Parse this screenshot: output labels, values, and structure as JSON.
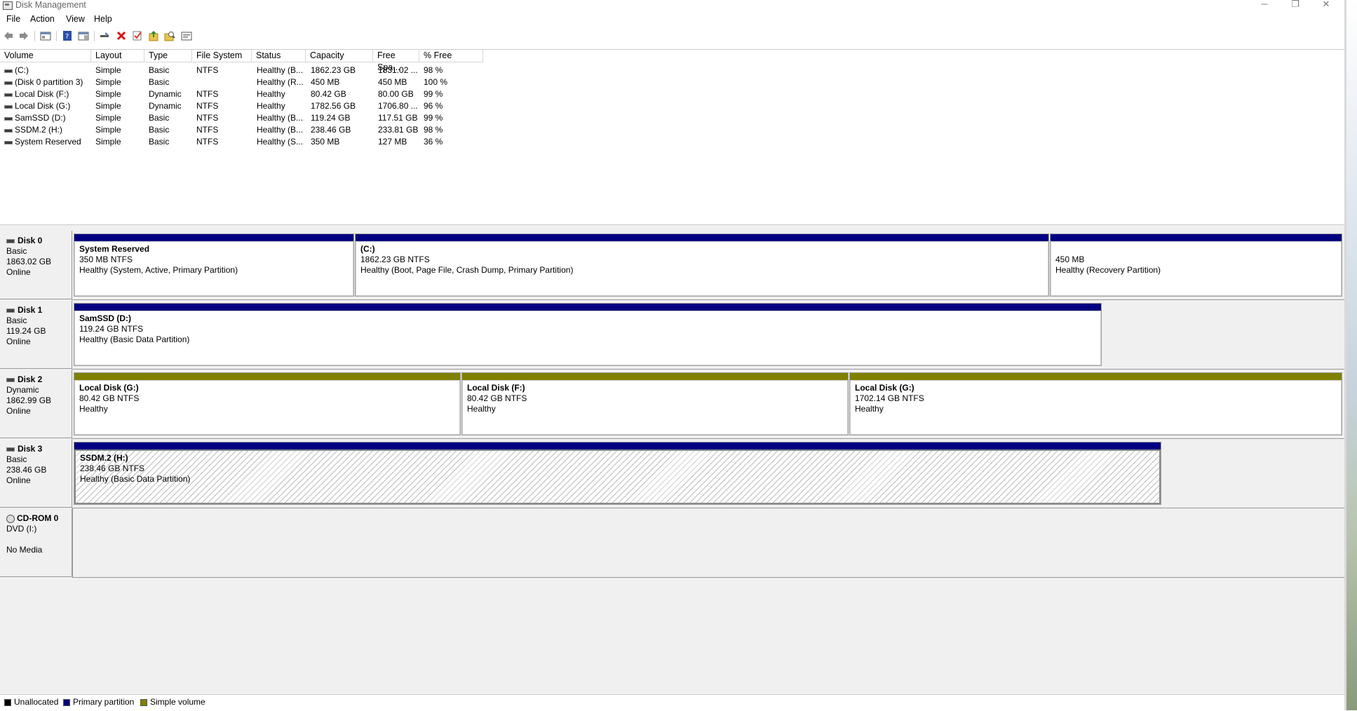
{
  "window": {
    "title": "Disk Management",
    "controls": {
      "minimize": "─",
      "restore": "❐",
      "close": "✕"
    }
  },
  "menu": [
    "File",
    "Action",
    "View",
    "Help"
  ],
  "list": {
    "columns": [
      "Volume",
      "Layout",
      "Type",
      "File System",
      "Status",
      "Capacity",
      "Free Spa...",
      "% Free"
    ],
    "rows": [
      [
        "(C:)",
        "Simple",
        "Basic",
        "NTFS",
        "Healthy (B...",
        "1862.23 GB",
        "1831.02 ...",
        "98 %"
      ],
      [
        "(Disk 0 partition 3)",
        "Simple",
        "Basic",
        "",
        "Healthy (R...",
        "450 MB",
        "450 MB",
        "100 %"
      ],
      [
        "Local Disk  (F:)",
        "Simple",
        "Dynamic",
        "NTFS",
        "Healthy",
        "80.42 GB",
        "80.00 GB",
        "99 %"
      ],
      [
        "Local Disk (G:)",
        "Simple",
        "Dynamic",
        "NTFS",
        "Healthy",
        "1782.56 GB",
        "1706.80 ...",
        "96 %"
      ],
      [
        "SamSSD (D:)",
        "Simple",
        "Basic",
        "NTFS",
        "Healthy (B...",
        "119.24 GB",
        "117.51 GB",
        "99 %"
      ],
      [
        "SSDM.2 (H:)",
        "Simple",
        "Basic",
        "NTFS",
        "Healthy (B...",
        "238.46 GB",
        "233.81 GB",
        "98 %"
      ],
      [
        "System Reserved",
        "Simple",
        "Basic",
        "NTFS",
        "Healthy (S...",
        "350 MB",
        "127 MB",
        "36 %"
      ]
    ]
  },
  "disks": [
    {
      "name": "Disk 0",
      "type": "Basic",
      "size": "1863.02 GB",
      "status": "Online",
      "partitions": [
        {
          "name": "System Reserved",
          "size": "350 MB NTFS",
          "status": "Healthy (System, Active, Primary Partition)",
          "bar": "primary"
        },
        {
          "name": "(C:)",
          "size": "1862.23 GB NTFS",
          "status": "Healthy (Boot, Page File, Crash Dump, Primary Partition)",
          "bar": "primary"
        },
        {
          "name": "",
          "size": "450 MB",
          "status": "Healthy (Recovery Partition)",
          "bar": "primary"
        }
      ]
    },
    {
      "name": "Disk 1",
      "type": "Basic",
      "size": "119.24 GB",
      "status": "Online",
      "partitions": [
        {
          "name": "SamSSD  (D:)",
          "size": "119.24 GB NTFS",
          "status": "Healthy (Basic Data Partition)",
          "bar": "primary"
        }
      ]
    },
    {
      "name": "Disk 2",
      "type": "Dynamic",
      "size": "1862.99 GB",
      "status": "Online",
      "partitions": [
        {
          "name": "Local Disk  (G:)",
          "size": "80.42 GB NTFS",
          "status": "Healthy",
          "bar": "simple"
        },
        {
          "name": "Local Disk   (F:)",
          "size": "80.42 GB NTFS",
          "status": "Healthy",
          "bar": "simple"
        },
        {
          "name": "Local Disk  (G:)",
          "size": "1702.14 GB NTFS",
          "status": "Healthy",
          "bar": "simple"
        }
      ]
    },
    {
      "name": "Disk 3",
      "type": "Basic",
      "size": "238.46 GB",
      "status": "Online",
      "partitions": [
        {
          "name": "SSDM.2  (H:)",
          "size": "238.46 GB NTFS",
          "status": "Healthy (Basic Data Partition)",
          "bar": "primary",
          "selected": true
        }
      ]
    }
  ],
  "cdrom": {
    "name": "CD-ROM 0",
    "type": "DVD (I:)",
    "status": "No Media"
  },
  "legend": [
    {
      "label": "Unallocated",
      "color": "#000000"
    },
    {
      "label": "Primary partition",
      "color": "#000080"
    },
    {
      "label": "Simple volume",
      "color": "#808000"
    }
  ],
  "colors": {
    "primary": "#000080",
    "simple": "#808000",
    "unallocated": "#000000"
  },
  "toolbar_icons": [
    "back-icon",
    "forward-icon",
    "properties-pane-icon",
    "help-icon",
    "view-pane-icon",
    "connect-icon",
    "delete-icon",
    "check-icon",
    "import-icon",
    "search-folder-icon",
    "console-icon"
  ]
}
